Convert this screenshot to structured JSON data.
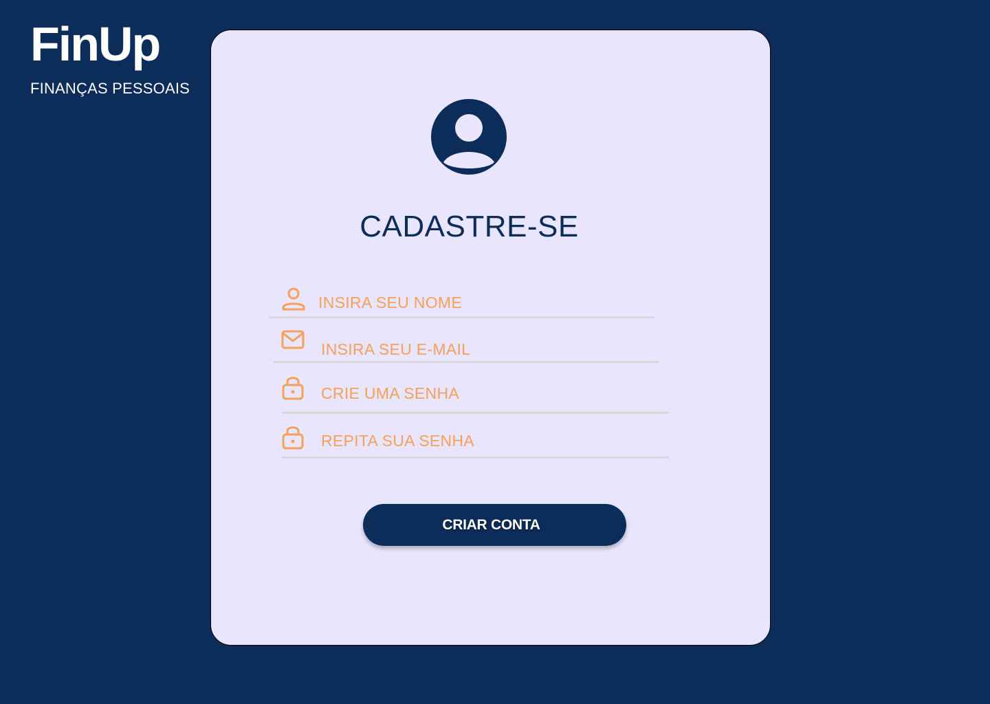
{
  "brand": {
    "name": "FinUp",
    "tagline": "FINANÇAS PESSOAIS"
  },
  "signup": {
    "title": "CADASTRE-SE",
    "fields": [
      {
        "icon": "user-icon",
        "placeholder": "INSIRA SEU NOME"
      },
      {
        "icon": "mail-icon",
        "placeholder": "INSIRA SEU E-MAIL"
      },
      {
        "icon": "lock-icon",
        "placeholder": "CRIE UMA SENHA"
      },
      {
        "icon": "lock-icon",
        "placeholder": "REPITA SUA SENHA"
      }
    ],
    "submit_label": "CRIAR CONTA"
  },
  "colors": {
    "background": "#0c2c59",
    "card": "#e8e5fd",
    "accent": "#f5a05b",
    "primary": "#0c2c59",
    "underline": "#d9d6dc"
  }
}
